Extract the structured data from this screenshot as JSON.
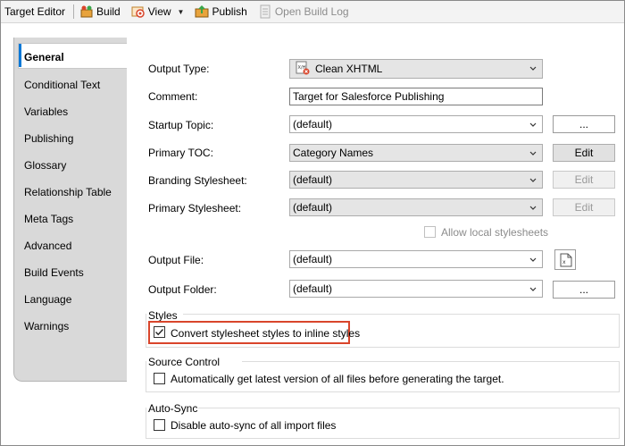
{
  "toolbar": {
    "title": "Target Editor",
    "build_label": "Build",
    "view_label": "View",
    "publish_label": "Publish",
    "open_build_log_label": "Open Build Log"
  },
  "tabs": [
    {
      "label": "General",
      "active": true
    },
    {
      "label": "Conditional Text"
    },
    {
      "label": "Variables"
    },
    {
      "label": "Publishing"
    },
    {
      "label": "Glossary"
    },
    {
      "label": "Relationship Table"
    },
    {
      "label": "Meta Tags"
    },
    {
      "label": "Advanced"
    },
    {
      "label": "Build Events"
    },
    {
      "label": "Language"
    },
    {
      "label": "Warnings"
    }
  ],
  "form": {
    "output_type": {
      "label": "Output Type:",
      "value": "Clean XHTML"
    },
    "comment": {
      "label": "Comment:",
      "value": "Target for Salesforce Publishing"
    },
    "startup_topic": {
      "label": "Startup Topic:",
      "value": "(default)",
      "button": "..."
    },
    "primary_toc": {
      "label": "Primary TOC:",
      "value": "Category Names",
      "button": "Edit"
    },
    "branding_stylesheet": {
      "label": "Branding Stylesheet:",
      "value": "(default)",
      "button": "Edit"
    },
    "primary_stylesheet": {
      "label": "Primary Stylesheet:",
      "value": "(default)",
      "button": "Edit"
    },
    "allow_local_stylesheets": {
      "label": "Allow local stylesheets",
      "checked": false
    },
    "output_file": {
      "label": "Output File:",
      "value": "(default)"
    },
    "output_folder": {
      "label": "Output Folder:",
      "value": "(default)",
      "button": "..."
    }
  },
  "groups": {
    "styles": {
      "title": "Styles",
      "checkbox_label": "Convert stylesheet styles to inline styles",
      "checked": true
    },
    "source_control": {
      "title": "Source Control",
      "checkbox_label": "Automatically get latest version of all files before generating the target.",
      "checked": false
    },
    "auto_sync": {
      "title": "Auto-Sync",
      "checkbox_label": "Disable auto-sync of all import files",
      "checked": false
    }
  },
  "colors": {
    "highlight_border": "#d9452b",
    "active_tab_focus": "#0078d7"
  }
}
